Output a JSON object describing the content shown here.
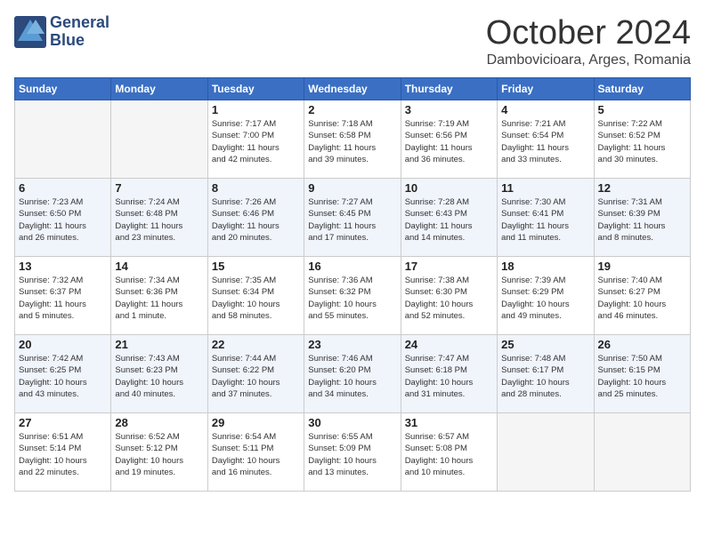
{
  "header": {
    "logo_line1": "General",
    "logo_line2": "Blue",
    "month": "October 2024",
    "location": "Dambovicioara, Arges, Romania"
  },
  "days_of_week": [
    "Sunday",
    "Monday",
    "Tuesday",
    "Wednesday",
    "Thursday",
    "Friday",
    "Saturday"
  ],
  "weeks": [
    [
      {
        "day": "",
        "info": ""
      },
      {
        "day": "",
        "info": ""
      },
      {
        "day": "1",
        "info": "Sunrise: 7:17 AM\nSunset: 7:00 PM\nDaylight: 11 hours\nand 42 minutes."
      },
      {
        "day": "2",
        "info": "Sunrise: 7:18 AM\nSunset: 6:58 PM\nDaylight: 11 hours\nand 39 minutes."
      },
      {
        "day": "3",
        "info": "Sunrise: 7:19 AM\nSunset: 6:56 PM\nDaylight: 11 hours\nand 36 minutes."
      },
      {
        "day": "4",
        "info": "Sunrise: 7:21 AM\nSunset: 6:54 PM\nDaylight: 11 hours\nand 33 minutes."
      },
      {
        "day": "5",
        "info": "Sunrise: 7:22 AM\nSunset: 6:52 PM\nDaylight: 11 hours\nand 30 minutes."
      }
    ],
    [
      {
        "day": "6",
        "info": "Sunrise: 7:23 AM\nSunset: 6:50 PM\nDaylight: 11 hours\nand 26 minutes."
      },
      {
        "day": "7",
        "info": "Sunrise: 7:24 AM\nSunset: 6:48 PM\nDaylight: 11 hours\nand 23 minutes."
      },
      {
        "day": "8",
        "info": "Sunrise: 7:26 AM\nSunset: 6:46 PM\nDaylight: 11 hours\nand 20 minutes."
      },
      {
        "day": "9",
        "info": "Sunrise: 7:27 AM\nSunset: 6:45 PM\nDaylight: 11 hours\nand 17 minutes."
      },
      {
        "day": "10",
        "info": "Sunrise: 7:28 AM\nSunset: 6:43 PM\nDaylight: 11 hours\nand 14 minutes."
      },
      {
        "day": "11",
        "info": "Sunrise: 7:30 AM\nSunset: 6:41 PM\nDaylight: 11 hours\nand 11 minutes."
      },
      {
        "day": "12",
        "info": "Sunrise: 7:31 AM\nSunset: 6:39 PM\nDaylight: 11 hours\nand 8 minutes."
      }
    ],
    [
      {
        "day": "13",
        "info": "Sunrise: 7:32 AM\nSunset: 6:37 PM\nDaylight: 11 hours\nand 5 minutes."
      },
      {
        "day": "14",
        "info": "Sunrise: 7:34 AM\nSunset: 6:36 PM\nDaylight: 11 hours\nand 1 minute."
      },
      {
        "day": "15",
        "info": "Sunrise: 7:35 AM\nSunset: 6:34 PM\nDaylight: 10 hours\nand 58 minutes."
      },
      {
        "day": "16",
        "info": "Sunrise: 7:36 AM\nSunset: 6:32 PM\nDaylight: 10 hours\nand 55 minutes."
      },
      {
        "day": "17",
        "info": "Sunrise: 7:38 AM\nSunset: 6:30 PM\nDaylight: 10 hours\nand 52 minutes."
      },
      {
        "day": "18",
        "info": "Sunrise: 7:39 AM\nSunset: 6:29 PM\nDaylight: 10 hours\nand 49 minutes."
      },
      {
        "day": "19",
        "info": "Sunrise: 7:40 AM\nSunset: 6:27 PM\nDaylight: 10 hours\nand 46 minutes."
      }
    ],
    [
      {
        "day": "20",
        "info": "Sunrise: 7:42 AM\nSunset: 6:25 PM\nDaylight: 10 hours\nand 43 minutes."
      },
      {
        "day": "21",
        "info": "Sunrise: 7:43 AM\nSunset: 6:23 PM\nDaylight: 10 hours\nand 40 minutes."
      },
      {
        "day": "22",
        "info": "Sunrise: 7:44 AM\nSunset: 6:22 PM\nDaylight: 10 hours\nand 37 minutes."
      },
      {
        "day": "23",
        "info": "Sunrise: 7:46 AM\nSunset: 6:20 PM\nDaylight: 10 hours\nand 34 minutes."
      },
      {
        "day": "24",
        "info": "Sunrise: 7:47 AM\nSunset: 6:18 PM\nDaylight: 10 hours\nand 31 minutes."
      },
      {
        "day": "25",
        "info": "Sunrise: 7:48 AM\nSunset: 6:17 PM\nDaylight: 10 hours\nand 28 minutes."
      },
      {
        "day": "26",
        "info": "Sunrise: 7:50 AM\nSunset: 6:15 PM\nDaylight: 10 hours\nand 25 minutes."
      }
    ],
    [
      {
        "day": "27",
        "info": "Sunrise: 6:51 AM\nSunset: 5:14 PM\nDaylight: 10 hours\nand 22 minutes."
      },
      {
        "day": "28",
        "info": "Sunrise: 6:52 AM\nSunset: 5:12 PM\nDaylight: 10 hours\nand 19 minutes."
      },
      {
        "day": "29",
        "info": "Sunrise: 6:54 AM\nSunset: 5:11 PM\nDaylight: 10 hours\nand 16 minutes."
      },
      {
        "day": "30",
        "info": "Sunrise: 6:55 AM\nSunset: 5:09 PM\nDaylight: 10 hours\nand 13 minutes."
      },
      {
        "day": "31",
        "info": "Sunrise: 6:57 AM\nSunset: 5:08 PM\nDaylight: 10 hours\nand 10 minutes."
      },
      {
        "day": "",
        "info": ""
      },
      {
        "day": "",
        "info": ""
      }
    ]
  ]
}
